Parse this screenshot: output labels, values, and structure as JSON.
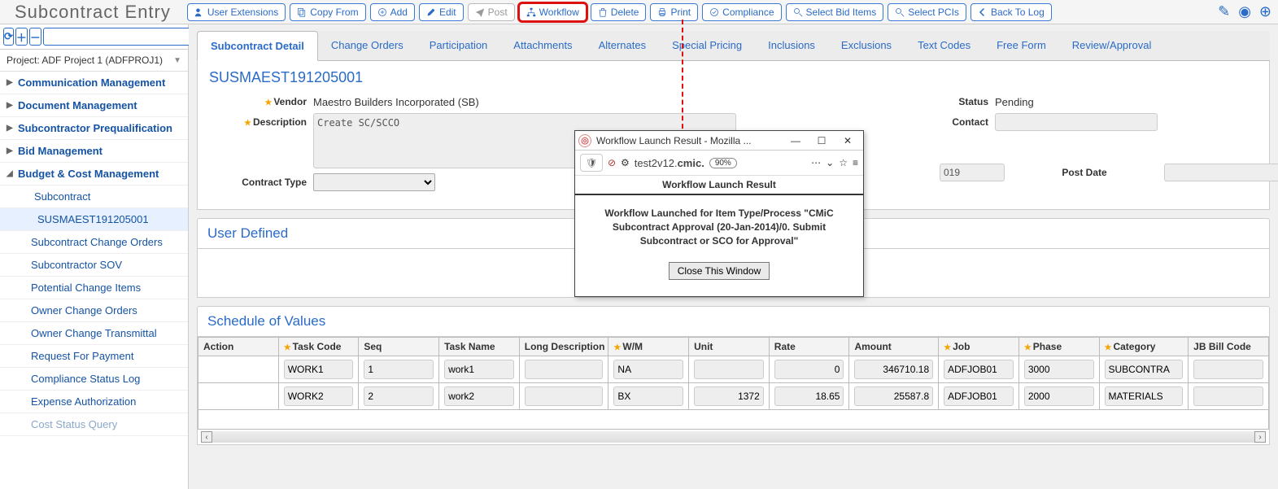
{
  "page_title": "Subcontract Entry",
  "toolbar": {
    "user_extensions": "User Extensions",
    "copy_from": "Copy From",
    "add": "Add",
    "edit": "Edit",
    "post": "Post",
    "workflow": "Workflow",
    "delete": "Delete",
    "print": "Print",
    "compliance": "Compliance",
    "select_bid_items": "Select Bid Items",
    "select_pcis": "Select PCIs",
    "back_to_log": "Back To Log"
  },
  "project_label": "Project: ADF Project 1 (ADFPROJ1)",
  "sidebar": {
    "items": [
      {
        "label": "Communication Management"
      },
      {
        "label": "Document Management"
      },
      {
        "label": "Subcontractor Prequalification"
      },
      {
        "label": "Bid Management"
      },
      {
        "label": "Budget & Cost Management",
        "expanded": true
      }
    ],
    "subcontract_label": "Subcontract",
    "record_label": "SUSMAEST191205001",
    "sub_items": [
      "Subcontract Change Orders",
      "Subcontractor SOV",
      "Potential Change Items",
      "Owner Change Orders",
      "Owner Change Transmittal",
      "Request For Payment",
      "Compliance Status Log",
      "Expense Authorization",
      "Cost Status Query"
    ]
  },
  "tabs": [
    "Subcontract Detail",
    "Change Orders",
    "Participation",
    "Attachments",
    "Alternates",
    "Special Pricing",
    "Inclusions",
    "Exclusions",
    "Text Codes",
    "Free Form",
    "Review/Approval"
  ],
  "detail": {
    "record_id": "SUSMAEST191205001",
    "vendor_label": "Vendor",
    "vendor_value": "Maestro Builders Incorporated (SB)",
    "status_label": "Status",
    "status_value": "Pending",
    "description_label": "Description",
    "description_value": "Create SC/SCCO",
    "contact_label": "Contact",
    "contract_type_label": "Contract Type",
    "date_suffix": "019",
    "post_date_label": "Post Date"
  },
  "user_defined_title": "User Defined",
  "sov_title": "Schedule of Values",
  "sov_headers": {
    "action": "Action",
    "task_code": "Task Code",
    "seq": "Seq",
    "task_name": "Task Name",
    "long_desc": "Long Description",
    "wm": "W/M",
    "unit": "Unit",
    "rate": "Rate",
    "amount": "Amount",
    "job": "Job",
    "phase": "Phase",
    "category": "Category",
    "jb_bill": "JB Bill Code"
  },
  "sov_rows": [
    {
      "task_code": "WORK1",
      "seq": "1",
      "task_name": "work1",
      "long_desc": "",
      "wm": "NA",
      "unit": "",
      "rate": "0",
      "amount": "346710.18",
      "job": "ADFJOB01",
      "phase": "3000",
      "category": "SUBCONTRA"
    },
    {
      "task_code": "WORK2",
      "seq": "2",
      "task_name": "work2",
      "long_desc": "",
      "wm": "BX",
      "unit": "1372",
      "rate": "18.65",
      "amount": "25587.8",
      "job": "ADFJOB01",
      "phase": "2000",
      "category": "MATERIALS"
    }
  ],
  "popup": {
    "window_title": "Workflow Launch Result - Mozilla ...",
    "url_host": "test2v12.",
    "url_bold": "cmic.",
    "zoom": "90%",
    "header": "Workflow Launch Result",
    "message": "Workflow Launched for Item Type/Process \"CMiC Subcontract Approval (20-Jan-2014)/0. Submit Subcontract or SCO for Approval\"",
    "close_btn": "Close This Window"
  }
}
